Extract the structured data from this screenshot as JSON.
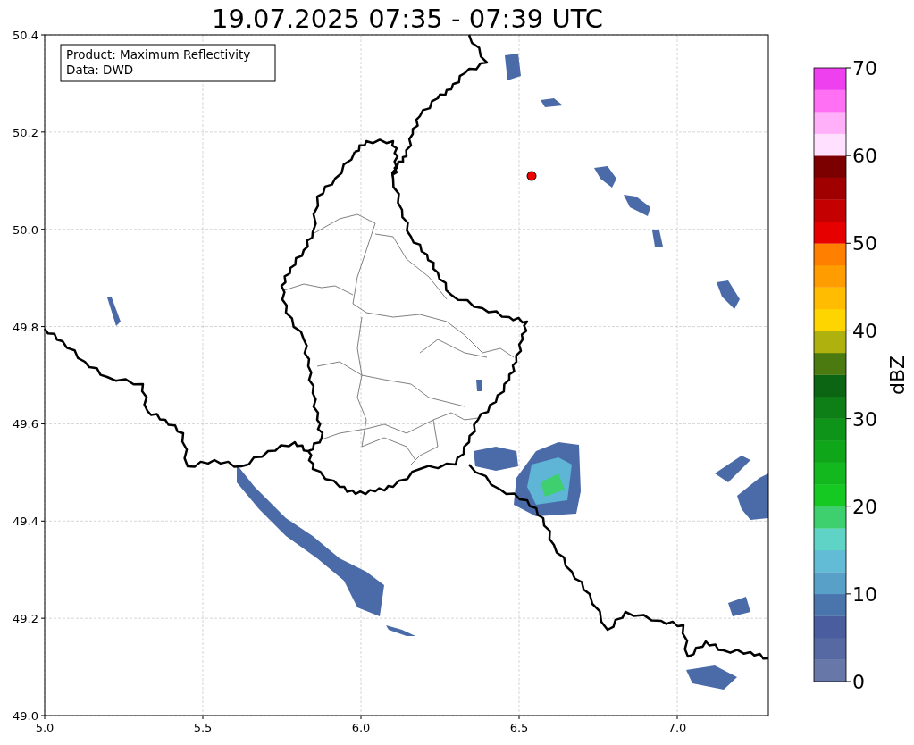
{
  "title": "19.07.2025 07:35 - 07:39 UTC",
  "info_box": [
    "Product: Maximum Reflectivity",
    "Data: DWD"
  ],
  "x_axis": {
    "ticks": [
      "5.0",
      "5.5",
      "6.0",
      "6.5",
      "7.0"
    ]
  },
  "y_axis": {
    "ticks": [
      "50.4",
      "50.2",
      "50.0",
      "49.8",
      "49.6",
      "49.4",
      "49.2",
      "49.0"
    ]
  },
  "colorbar": {
    "label": "dBZ",
    "ticks": [
      "70",
      "60",
      "50",
      "40",
      "30",
      "20",
      "10",
      "0"
    ],
    "segments": [
      {
        "color": "#6777a8"
      },
      {
        "color": "#5669a2"
      },
      {
        "color": "#4a5e9f"
      },
      {
        "color": "#4a74ac"
      },
      {
        "color": "#58a0c8"
      },
      {
        "color": "#62bcd6"
      },
      {
        "color": "#60d3c7"
      },
      {
        "color": "#3ed06e"
      },
      {
        "color": "#16c822"
      },
      {
        "color": "#12b81e"
      },
      {
        "color": "#10a61a"
      },
      {
        "color": "#0e9418"
      },
      {
        "color": "#0d7f16"
      },
      {
        "color": "#0b6512"
      },
      {
        "color": "#4a7a10"
      },
      {
        "color": "#afb20e"
      },
      {
        "color": "#ffd500"
      },
      {
        "color": "#ffbc00"
      },
      {
        "color": "#ff9c00"
      },
      {
        "color": "#ff7f00"
      },
      {
        "color": "#e60000"
      },
      {
        "color": "#c40000"
      },
      {
        "color": "#a00000"
      },
      {
        "color": "#7d0000"
      },
      {
        "color": "#ffe0ff"
      },
      {
        "color": "#ffb0f8"
      },
      {
        "color": "#ff70f4"
      },
      {
        "color": "#ee40ee"
      }
    ]
  }
}
